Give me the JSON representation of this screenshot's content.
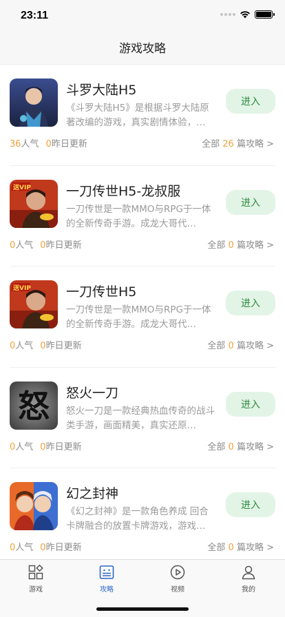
{
  "status": {
    "time": "23:11"
  },
  "nav": {
    "title": "游戏攻略"
  },
  "games": [
    {
      "name": "斗罗大陆H5",
      "desc": "《斗罗大陆H5》是根据斗罗大陆原著改编的游戏，真实剧情体验，…",
      "popularity": "36",
      "popularity_label": "人气",
      "updated": "0",
      "updated_label": "昨日更新",
      "all_label": "全部",
      "guides": "26",
      "guides_label": "篇攻略 >",
      "button": "进入",
      "icon": "douluo-icon"
    },
    {
      "name": "一刀传世H5-龙叔服",
      "desc": "一刀传世是一款MMO与RPG于一体的全新传奇手游。成龙大哥代…",
      "popularity": "0",
      "popularity_label": "人气",
      "updated": "0",
      "updated_label": "昨日更新",
      "all_label": "全部",
      "guides": "0",
      "guides_label": "篇攻略 >",
      "button": "进入",
      "icon": "yidao-vip-icon",
      "badge": "送VIP"
    },
    {
      "name": "一刀传世H5",
      "desc": "一刀传世是一款MMO与RPG于一体的全新传奇手游。成龙大哥代…",
      "popularity": "0",
      "popularity_label": "人气",
      "updated": "0",
      "updated_label": "昨日更新",
      "all_label": "全部",
      "guides": "0",
      "guides_label": "篇攻略 >",
      "button": "进入",
      "icon": "yidao-vip-icon",
      "badge": "送VIP"
    },
    {
      "name": "怒火一刀",
      "desc": "怒火一刀是一款经典热血传奇的战斗类手游，画面精美，真实还原…",
      "popularity": "0",
      "popularity_label": "人气",
      "updated": "0",
      "updated_label": "昨日更新",
      "all_label": "全部",
      "guides": "0",
      "guides_label": "篇攻略 >",
      "button": "进入",
      "icon": "nuhuo-icon",
      "glyph": "怒"
    },
    {
      "name": "幻之封神",
      "desc": "《幻之封神》是一款角色养成 回合卡牌融合的放置卡牌游戏，游戏…",
      "popularity": "0",
      "popularity_label": "人气",
      "updated": "0",
      "updated_label": "昨日更新",
      "all_label": "全部",
      "guides": "0",
      "guides_label": "篇攻略 >",
      "button": "进入",
      "icon": "huanzhi-icon"
    }
  ],
  "tabs": [
    {
      "label": "游戏",
      "icon": "grid-icon",
      "active": false
    },
    {
      "label": "攻略",
      "icon": "guide-icon",
      "active": true
    },
    {
      "label": "视频",
      "icon": "play-icon",
      "active": false
    },
    {
      "label": "我的",
      "icon": "user-icon",
      "active": false
    }
  ],
  "colors": {
    "accent": "#2e67c9",
    "button_bg": "#e2f4e6",
    "button_text": "#2e8a3e",
    "number": "#f0a23c"
  }
}
